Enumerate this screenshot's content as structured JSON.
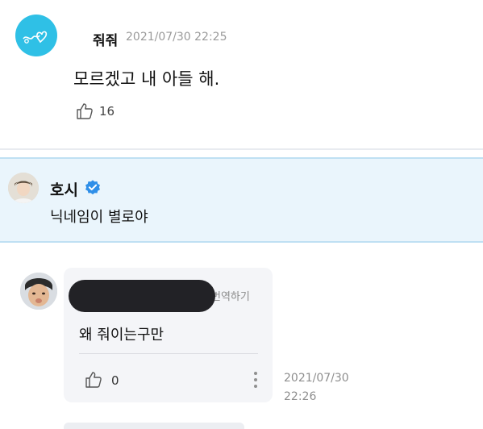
{
  "comments": [
    {
      "author": "줘줘",
      "time": "2021/07/30 22:25",
      "text": "모르겠고 내 아들 해.",
      "likes": "16",
      "avatar_icon": "heart-doodle-avatar"
    }
  ],
  "artist_reply": {
    "author": "호시",
    "verified": true,
    "text": "닉네임이 별로야",
    "background": "#eaf5fc"
  },
  "reply": {
    "translate_label": "번역하기",
    "text": "왜 줘이는구만",
    "likes": "0",
    "time_date": "2021/07/30",
    "time_clock": "22:26"
  },
  "colors": {
    "accent": "#2f8fe8",
    "avatar1": "#2fc0e6"
  }
}
